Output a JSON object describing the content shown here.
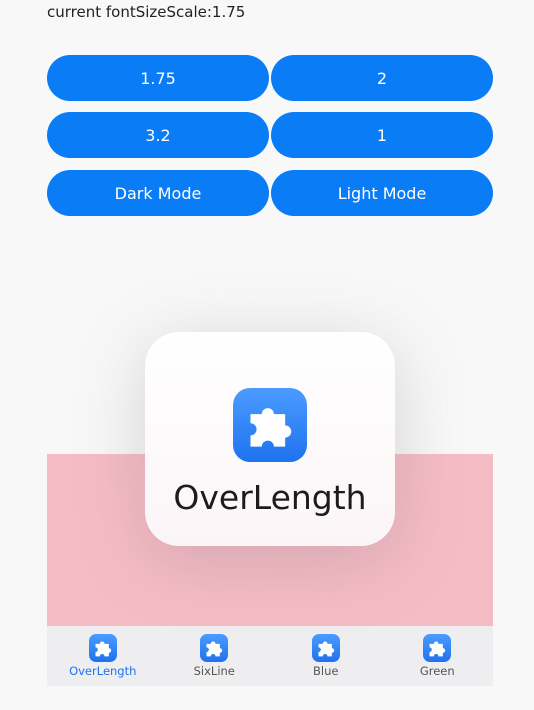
{
  "status_text": "current fontSizeScale:1.75",
  "buttons": [
    {
      "label": "1.75"
    },
    {
      "label": "2"
    },
    {
      "label": "3.2"
    },
    {
      "label": "1"
    },
    {
      "label": "Dark Mode"
    },
    {
      "label": "Light Mode"
    }
  ],
  "card": {
    "icon": "puzzle-icon",
    "title": "OverLength"
  },
  "tabs": [
    {
      "label": "OverLength",
      "icon": "puzzle-icon",
      "active": true
    },
    {
      "label": "SixLine",
      "icon": "puzzle-icon",
      "active": false
    },
    {
      "label": "Blue",
      "icon": "puzzle-icon",
      "active": false
    },
    {
      "label": "Green",
      "icon": "puzzle-icon",
      "active": false
    }
  ],
  "colors": {
    "button_blue": "#0a7cf5",
    "active_tab": "#1f72ee",
    "pink_background": "#f6bcc5",
    "tab_bar_background": "#eeeef1"
  }
}
